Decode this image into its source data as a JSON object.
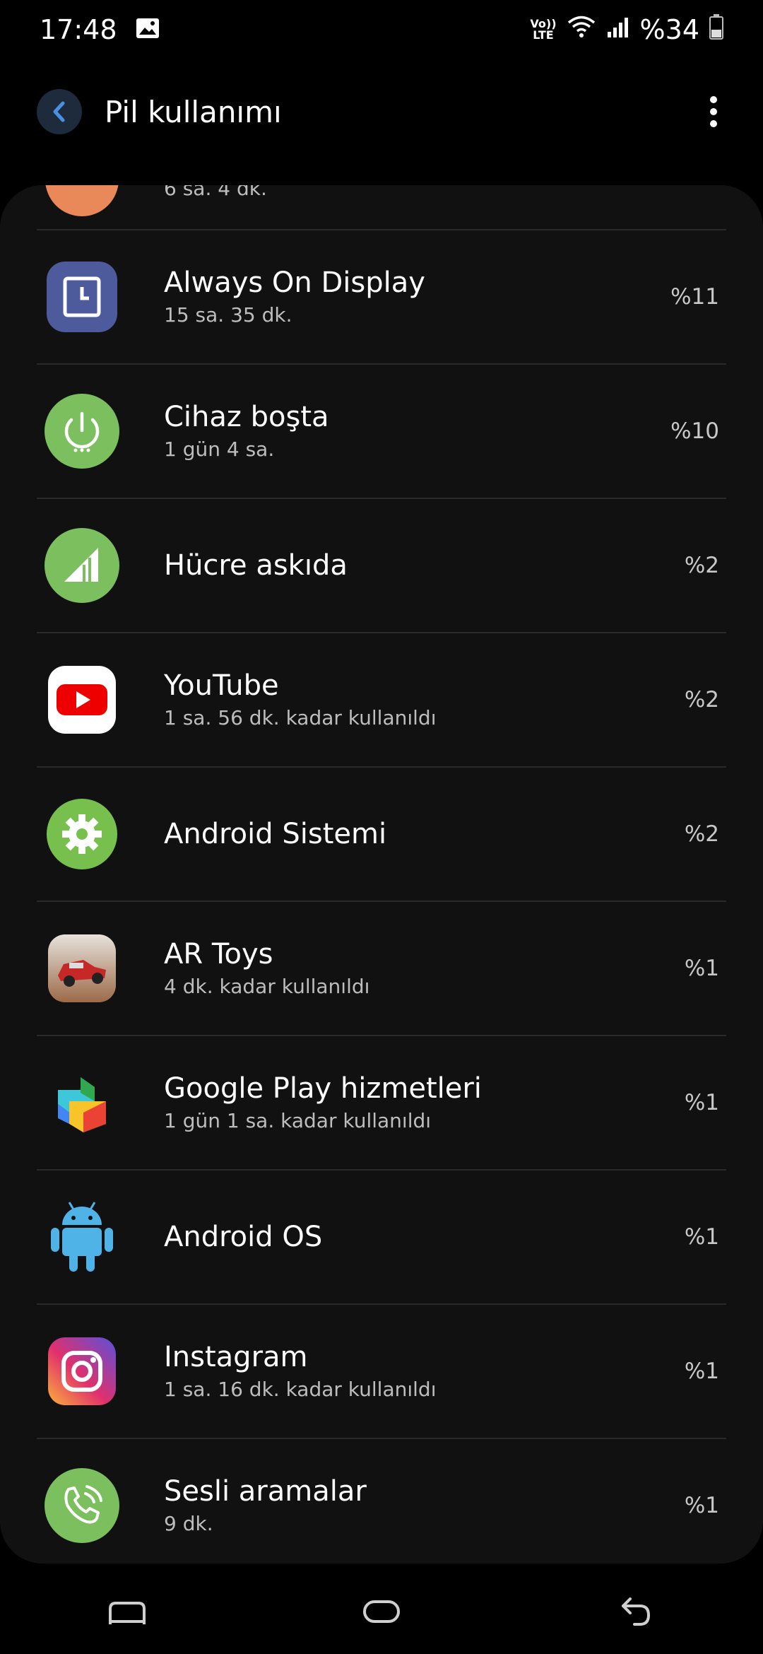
{
  "status": {
    "time": "17:48",
    "battery": "%34",
    "volte_top": "Vo))",
    "volte_bottom": "LTE"
  },
  "header": {
    "title": "Pil kullanımı"
  },
  "partial_row": {
    "subtitle": "6 sa. 4 dk."
  },
  "apps": [
    {
      "name": "Always On Display",
      "subtitle": "15 sa. 35 dk.",
      "percent": "%11",
      "icon": "always-on-display-icon"
    },
    {
      "name": "Cihaz boşta",
      "subtitle": "1 gün 4 sa.",
      "percent": "%10",
      "icon": "power-idle-icon"
    },
    {
      "name": "Hücre askıda",
      "subtitle": "",
      "percent": "%2",
      "icon": "cell-signal-icon"
    },
    {
      "name": "YouTube",
      "subtitle": "1 sa. 56 dk. kadar kullanıldı",
      "percent": "%2",
      "icon": "youtube-icon"
    },
    {
      "name": "Android Sistemi",
      "subtitle": "",
      "percent": "%2",
      "icon": "gear-icon"
    },
    {
      "name": "AR Toys",
      "subtitle": "4 dk. kadar kullanıldı",
      "percent": "%1",
      "icon": "ar-toys-icon"
    },
    {
      "name": "Google Play hizmetleri",
      "subtitle": "1 gün 1 sa. kadar kullanıldı",
      "percent": "%1",
      "icon": "google-play-services-icon"
    },
    {
      "name": "Android OS",
      "subtitle": "",
      "percent": "%1",
      "icon": "android-robot-icon"
    },
    {
      "name": "Instagram",
      "subtitle": "1 sa. 16 dk. kadar kullanıldı",
      "percent": "%1",
      "icon": "instagram-icon"
    },
    {
      "name": "Sesli aramalar",
      "subtitle": "9 dk.",
      "percent": "%1",
      "icon": "phone-call-icon"
    }
  ],
  "colors": {
    "background": "#000000",
    "card": "#111111",
    "divider": "#2a2a2a",
    "accent_blue": "#4a8fe0",
    "green_icon": "#7cbf5e"
  }
}
